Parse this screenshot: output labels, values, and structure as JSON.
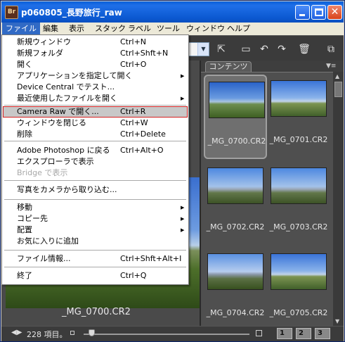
{
  "window": {
    "app_icon": "Br",
    "title": "p060805_長野旅行_raw",
    "controls": {
      "minimize": "minimize-icon",
      "maximize": "maximize-icon",
      "close": "✕"
    }
  },
  "menubar": {
    "items": [
      {
        "label": "ファイル",
        "active": true
      },
      {
        "label": "編集"
      },
      {
        "label": "表示"
      },
      {
        "label": "スタック"
      },
      {
        "label": "ラベル"
      },
      {
        "label": "ツール"
      },
      {
        "label": "ウィンドウ"
      },
      {
        "label": "ヘルプ"
      }
    ]
  },
  "file_menu": {
    "items": [
      {
        "label": "新規ウィンドウ",
        "shortcut": "Ctrl+N"
      },
      {
        "label": "新規フォルダ",
        "shortcut": "Ctrl+Shft+N"
      },
      {
        "label": "開く",
        "shortcut": "Ctrl+O"
      },
      {
        "label": "アプリケーションを指定して開く",
        "submenu": "▶"
      },
      {
        "label": "Device Central でテスト..."
      },
      {
        "label": "最近使用したファイルを開く",
        "submenu": "▶"
      },
      {
        "label": "Camera Raw で開く...",
        "shortcut": "Ctrl+R",
        "highlighted": true
      },
      {
        "label": "ウィンドウを閉じる",
        "shortcut": "Ctrl+W"
      },
      {
        "label": "削除",
        "shortcut": "Ctrl+Delete"
      },
      {
        "label": "Adobe Photoshop に戻る",
        "shortcut": "Ctrl+Alt+O"
      },
      {
        "label": "エクスプローラで表示"
      },
      {
        "label": "Bridge で表示",
        "disabled": true
      },
      {
        "label": "写真をカメラから取り込む..."
      },
      {
        "label": "移動",
        "submenu": "▶"
      },
      {
        "label": "コピー先",
        "submenu": "▶"
      },
      {
        "label": "配置",
        "submenu": "▶"
      },
      {
        "label": "お気に入りに追加"
      },
      {
        "label": "ファイル情報...",
        "shortcut": "Ctrl+Shft+Alt+I"
      },
      {
        "label": "終了",
        "shortcut": "Ctrl+Q"
      }
    ]
  },
  "toolbar": {
    "path_combo_arrow": "▼",
    "icons": [
      "folder-up-icon",
      "new-folder-icon",
      "rotate-left-icon",
      "rotate-right-icon",
      "trash-icon",
      "switch-view-icon"
    ]
  },
  "preview": {
    "caption": "_MG_0700.CR2"
  },
  "content": {
    "tab_label": "コンテンツ",
    "tab_menu": "▼≡",
    "thumbnails": [
      {
        "label": "_MG_0700.CR2",
        "selected": true
      },
      {
        "label": "_MG_0701.CR2"
      },
      {
        "label": "_MG_0702.CR2"
      },
      {
        "label": "_MG_0703.CR2"
      },
      {
        "label": "_MG_0704.CR2"
      },
      {
        "label": "_MG_0705.CR2"
      }
    ]
  },
  "statusbar": {
    "nav": "◀▶",
    "count": "228 項目。",
    "zoom_level": 0.05,
    "views": [
      "1",
      "2",
      "3"
    ]
  }
}
